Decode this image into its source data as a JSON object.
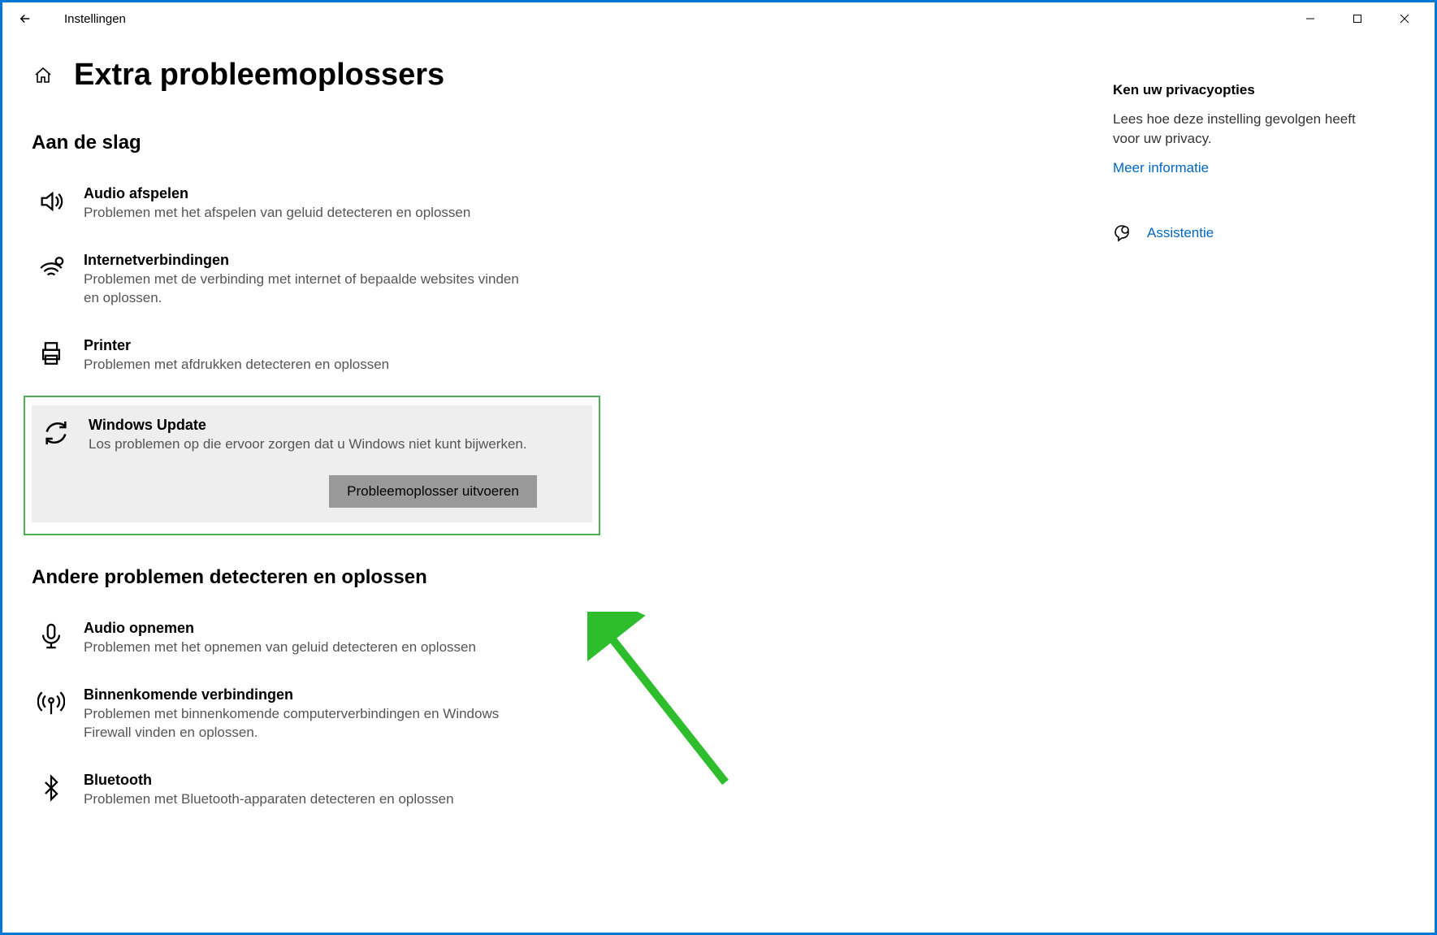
{
  "titlebar": {
    "app_name": "Instellingen"
  },
  "page": {
    "title": "Extra probleemoplossers"
  },
  "section1": {
    "title": "Aan de slag",
    "items": {
      "audio": {
        "title": "Audio afspelen",
        "desc": "Problemen met het afspelen van geluid detecteren en oplossen"
      },
      "internet": {
        "title": "Internetverbindingen",
        "desc": "Problemen met de verbinding met internet of bepaalde websites vinden en oplossen."
      },
      "printer": {
        "title": "Printer",
        "desc": "Problemen met afdrukken detecteren en oplossen"
      },
      "update": {
        "title": "Windows Update",
        "desc": "Los problemen op die ervoor zorgen dat u Windows niet kunt bijwerken.",
        "run_label": "Probleemoplosser uitvoeren"
      }
    }
  },
  "section2": {
    "title": "Andere problemen detecteren en oplossen",
    "items": {
      "record": {
        "title": "Audio opnemen",
        "desc": "Problemen met het opnemen van geluid detecteren en oplossen"
      },
      "incoming": {
        "title": "Binnenkomende verbindingen",
        "desc": "Problemen met binnenkomende computerverbindingen en Windows Firewall vinden en oplossen."
      },
      "bluetooth": {
        "title": "Bluetooth",
        "desc": "Problemen met Bluetooth-apparaten detecteren en oplossen"
      }
    }
  },
  "sidebar": {
    "privacy_title": "Ken uw privacyopties",
    "privacy_text": "Lees hoe deze instelling gevolgen heeft voor uw privacy.",
    "more_info": "Meer informatie",
    "assist": "Assistentie"
  }
}
